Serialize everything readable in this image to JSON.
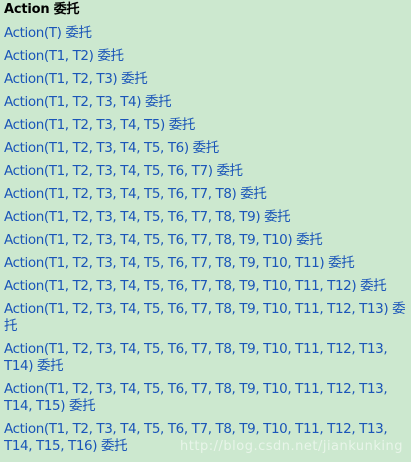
{
  "heading": "Action 委托",
  "links": [
    "Action(T) 委托",
    "Action(T1, T2) 委托",
    "Action(T1, T2, T3) 委托",
    "Action(T1, T2, T3, T4) 委托",
    "Action(T1, T2, T3, T4, T5) 委托",
    "Action(T1, T2, T3, T4, T5, T6) 委托",
    "Action(T1, T2, T3, T4, T5, T6, T7) 委托",
    "Action(T1, T2, T3, T4, T5, T6, T7, T8) 委托",
    "Action(T1, T2, T3, T4, T5, T6, T7, T8, T9) 委托",
    "Action(T1, T2, T3, T4, T5, T6, T7, T8, T9, T10) 委托",
    "Action(T1, T2, T3, T4, T5, T6, T7, T8, T9, T10, T11) 委托",
    "Action(T1, T2, T3, T4, T5, T6, T7, T8, T9, T10, T11, T12) 委托",
    "Action(T1, T2, T3, T4, T5, T6, T7, T8, T9, T10, T11, T12, T13) 委托",
    "Action(T1, T2, T3, T4, T5, T6, T7, T8, T9, T10, T11, T12, T13, T14) 委托",
    "Action(T1, T2, T3, T4, T5, T6, T7, T8, T9, T10, T11, T12, T13, T14, T15) 委托",
    "Action(T1, T2, T3, T4, T5, T6, T7, T8, T9, T10, T11, T12, T13, T14, T15, T16) 委托"
  ],
  "watermark": "http://blog.csdn.net/jiankunking",
  "colors": {
    "background": "#cce8cf",
    "link": "#1a55b8",
    "heading": "#000000"
  }
}
